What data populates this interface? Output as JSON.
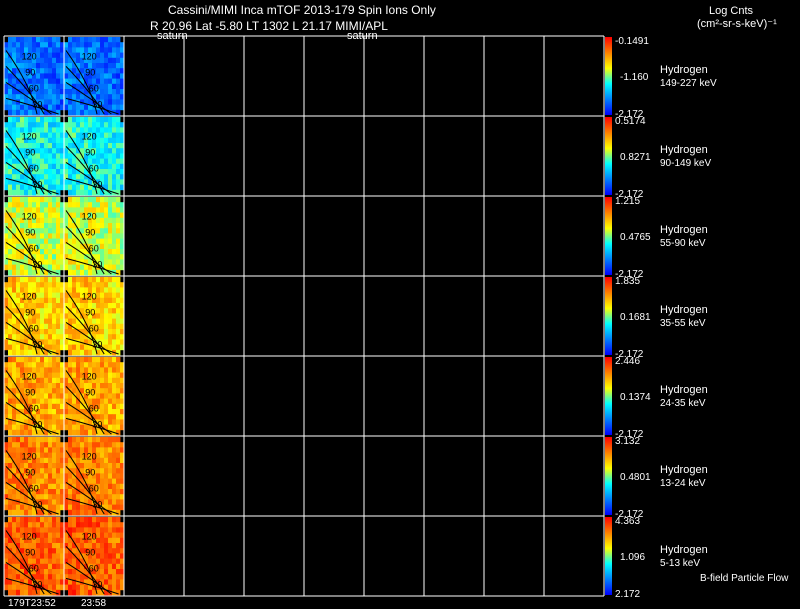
{
  "header": {
    "title": "Cassini/MIMI Inca mTOF  2013-179   Spin   Ions Only",
    "subtitle": "R         20.96 Lat -5.80 LT 1302 L          21.17  MIMI/APL",
    "saturn_labels": [
      "saturn",
      "saturn"
    ],
    "units_title": "Log Cnts",
    "units_formula": "(cm²-sr-s-keV)⁻¹"
  },
  "footer": {
    "time_labels": [
      "179T23:52",
      "23:58"
    ],
    "bfield_label": "B-field Particle Flow"
  },
  "chart_data": {
    "type": "heatmap",
    "title": "Cassini/MIMI Inca mTOF  2013-179   Spin   Ions Only",
    "grid": true,
    "columns": 10,
    "filled_columns": 2,
    "contour_labels": [
      "120",
      "90",
      "60",
      "30"
    ],
    "colors": [
      "#0000ff",
      "#0080ff",
      "#00ffff",
      "#ffff00",
      "#ff8000",
      "#ff0000"
    ],
    "panels": [
      {
        "species": "Hydrogen",
        "energy": "149-227 keV",
        "cbar_max": "-0.1491",
        "cbar_mid": "-1.160",
        "cbar_min": "-2.172",
        "level": 0.2
      },
      {
        "species": "Hydrogen",
        "energy": "90-149 keV",
        "cbar_max": "0.5174",
        "cbar_mid": "0.8271",
        "cbar_min": "-2.172",
        "level": 0.42
      },
      {
        "species": "Hydrogen",
        "energy": "55-90 keV",
        "cbar_max": "1.215",
        "cbar_mid": "0.4765",
        "cbar_min": "-2.172",
        "level": 0.6
      },
      {
        "species": "Hydrogen",
        "energy": "35-55 keV",
        "cbar_max": "1.835",
        "cbar_mid": "0.1681",
        "cbar_min": "-2.172",
        "level": 0.7
      },
      {
        "species": "Hydrogen",
        "energy": "24-35 keV",
        "cbar_max": "2.446",
        "cbar_mid": "0.1374",
        "cbar_min": "-2.172",
        "level": 0.76
      },
      {
        "species": "Hydrogen",
        "energy": "13-24 keV",
        "cbar_max": "3.132",
        "cbar_mid": "0.4801",
        "cbar_min": "-2.172",
        "level": 0.82
      },
      {
        "species": "Hydrogen",
        "energy": "5-13 keV",
        "cbar_max": "4.363",
        "cbar_mid": "1.096",
        "cbar_min": "2.172",
        "level": 0.88
      }
    ]
  }
}
